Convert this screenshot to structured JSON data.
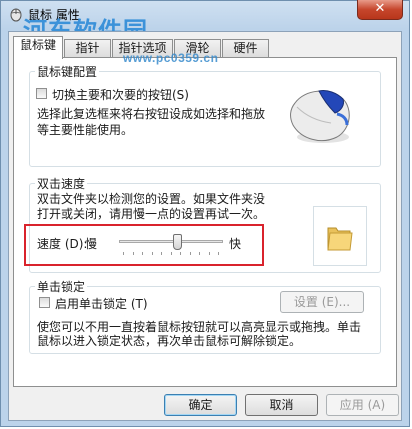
{
  "window": {
    "title": "鼠标 属性",
    "close_glyph": "✕"
  },
  "watermark": {
    "logo": "河东软件园",
    "url": "www.pc0359.cn"
  },
  "tabs": [
    {
      "label": "鼠标键",
      "active": true
    },
    {
      "label": "指针",
      "active": false
    },
    {
      "label": "指针选项",
      "active": false
    },
    {
      "label": "滑轮",
      "active": false
    },
    {
      "label": "硬件",
      "active": false
    }
  ],
  "button_config": {
    "title": "鼠标键配置",
    "switch_checkbox_label": "切换主要和次要的按钮(S)",
    "description": [
      "选择此复选框来将右按钮设成如选择和拖放",
      "等主要性能使用。"
    ]
  },
  "double_click": {
    "title": "双击速度",
    "description": [
      "双击文件夹以检测您的设置。如果文件夹没",
      "打开或关闭，请用慢一点的设置再试一次。"
    ],
    "speed_label": "速度 (D):",
    "slow_label": "慢",
    "fast_label": "快",
    "speed_value": 0.57,
    "folder_icon": "folder-icon"
  },
  "click_lock": {
    "title": "单击锁定",
    "enable_checkbox_label": "启用单击锁定 (T)",
    "settings_button": "设置 (E)...",
    "description": [
      "使您可以不用一直按着鼠标按钮就可以高亮显示或拖拽。单击",
      "鼠标以进入锁定状态，再次单击鼠标可解除锁定。"
    ]
  },
  "footer": {
    "ok": "确定",
    "cancel": "取消",
    "apply": "应用 (A)"
  },
  "colors": {
    "highlight_box": "#d9232c",
    "default_button_border": "#3c7fb1",
    "watermark_text": "#2e8bd8"
  }
}
